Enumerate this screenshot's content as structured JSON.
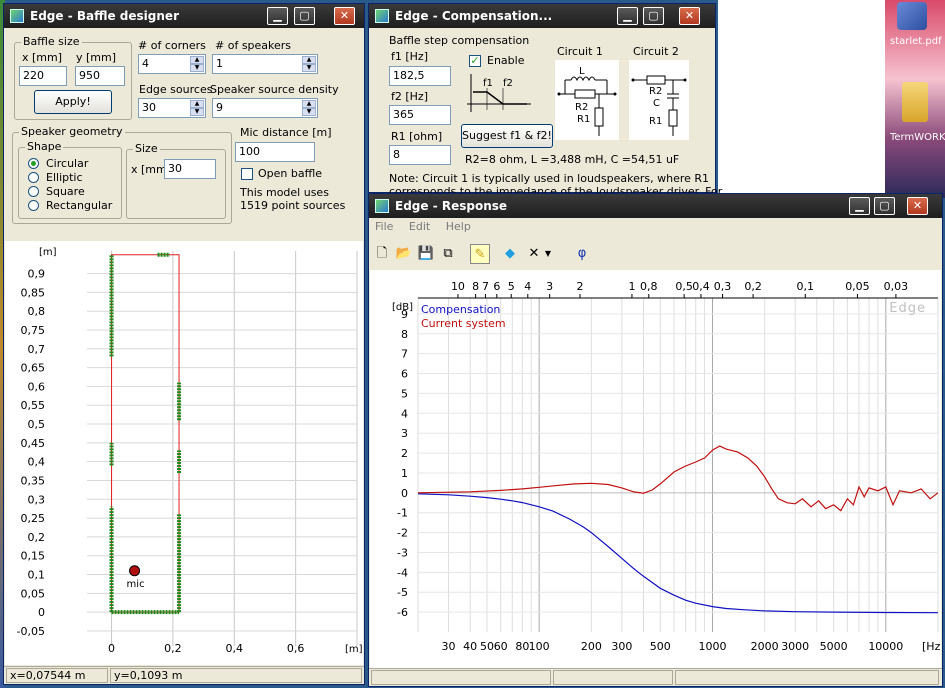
{
  "desktop": {
    "icon_label_1": "starlet.pdf",
    "icon_label_2": "TermWORK"
  },
  "baffle": {
    "title": "Edge - Baffle designer",
    "baffle_size": {
      "group_label": "Baffle size",
      "x_label": "x [mm]",
      "y_label": "y [mm]",
      "x_value": "220",
      "y_value": "950",
      "apply": "Apply!"
    },
    "corners_label": "# of corners",
    "corners_value": "4",
    "speakers_label": "# of speakers",
    "speakers_value": "1",
    "edge_label": "Edge sources",
    "edge_value": "30",
    "density_label": "Speaker source density",
    "density_value": "9",
    "geometry": {
      "group_label": "Speaker geometry",
      "shape_label": "Shape",
      "shapes": [
        "Circular",
        "Elliptic",
        "Square",
        "Rectangular"
      ],
      "selected": 0,
      "size_label": "Size",
      "x_label": "x [mm]",
      "x_value": "30"
    },
    "mic_label": "Mic distance [m]",
    "mic_value": "100",
    "open_baffle": "Open baffle",
    "model_text_1": "This model uses",
    "model_text_2": "1519 point sources",
    "status_x": "x=0,07544 m",
    "status_y": "y=0,1093 m"
  },
  "compensation": {
    "title": "Edge - Compensation...",
    "group_label": "Baffle step compensation",
    "f1_label": "f1 [Hz]",
    "f1_value": "182,5",
    "f2_label": "f2 [Hz]",
    "f2_value": "365",
    "r1_label": "R1 [ohm]",
    "r1_value": "8",
    "enable": "Enable",
    "graph_label_f1": "f1",
    "graph_label_f2": "f2",
    "circuit1": "Circuit 1",
    "circuit2": "Circuit 2",
    "c1_L": "L",
    "c1_R2": "R2",
    "c1_R1": "R1",
    "c2_R2": "R2",
    "c2_C": "C",
    "c2_R1": "R1",
    "suggest": "Suggest f1 & f2!",
    "result": "R2=8 ohm, L =3,488 mH, C =54,51 uF",
    "note_1": "Note: Circuit 1 is typically used in loudspeakers, where R1",
    "note_2": "corresponds to the impedance of the loudspeaker driver. For"
  },
  "response": {
    "title": "Edge - Response",
    "menu": [
      "File",
      "Edit",
      "Help"
    ],
    "tools": {
      "phi": "φ"
    },
    "watermark": "Edge",
    "legend": [
      "Compensation",
      "Current system"
    ],
    "colors": {
      "compensation": "#1010c0",
      "current": "#c01010"
    }
  },
  "chart_data": [
    {
      "type": "scatter",
      "title": "",
      "xlabel": "[m]",
      "ylabel": "[m]",
      "xlim": [
        -0.08,
        0.8
      ],
      "ylim": [
        -0.09,
        0.96
      ],
      "xticks": [
        "0",
        "0,2",
        "0,4",
        "0,6"
      ],
      "yticks": [
        "-0,05",
        "0",
        "0,05",
        "0,1",
        "0,15",
        "0,2",
        "0,25",
        "0,3",
        "0,35",
        "0,4",
        "0,45",
        "0,5",
        "0,55",
        "0,6",
        "0,65",
        "0,7",
        "0,75",
        "0,8",
        "0,85",
        "0,9"
      ],
      "baffle_outline": [
        [
          0,
          0
        ],
        [
          0.22,
          0
        ],
        [
          0.22,
          0.95
        ],
        [
          0,
          0.95
        ]
      ],
      "mic": {
        "x": 0.075,
        "y": 0.11,
        "label": "mic"
      },
      "edge_source_ranges": [
        {
          "edge": "left",
          "from": 0.0,
          "to": 0.28
        },
        {
          "edge": "left",
          "from": 0.39,
          "to": 0.45
        },
        {
          "edge": "left",
          "from": 0.68,
          "to": 0.95
        },
        {
          "edge": "right",
          "from": 0.0,
          "to": 0.26
        },
        {
          "edge": "right",
          "from": 0.37,
          "to": 0.43
        },
        {
          "edge": "right",
          "from": 0.51,
          "to": 0.61
        },
        {
          "edge": "bottom",
          "from": 0.0,
          "to": 0.22
        },
        {
          "edge": "top",
          "from": 0.15,
          "to": 0.19
        }
      ],
      "grid": true
    },
    {
      "type": "line",
      "x_scale": "log",
      "xlim": [
        20,
        20000
      ],
      "ylim": [
        -7,
        9.8
      ],
      "xlabel": "[Hz]",
      "ylabel": "[dB]",
      "xticks": [
        30,
        40,
        50,
        60,
        80,
        100,
        200,
        300,
        500,
        1000,
        2000,
        3000,
        5000,
        10000
      ],
      "yticks": [
        -6,
        -5,
        -4,
        -3,
        -2,
        -1,
        0,
        1,
        2,
        3,
        4,
        5,
        6,
        7,
        8,
        9
      ],
      "top_axis_ticks": [
        {
          "label": "10",
          "hz": 34
        },
        {
          "label": "8",
          "hz": 43
        },
        {
          "label": "7",
          "hz": 49
        },
        {
          "label": "6",
          "hz": 57
        },
        {
          "label": "5",
          "hz": 69
        },
        {
          "label": "4",
          "hz": 86
        },
        {
          "label": "3",
          "hz": 115
        },
        {
          "label": "2",
          "hz": 172
        },
        {
          "label": "1",
          "hz": 343
        },
        {
          "label": "0,8",
          "hz": 429
        },
        {
          "label": "0,5",
          "hz": 686
        },
        {
          "label": "0,4",
          "hz": 858
        },
        {
          "label": "0,3",
          "hz": 1143
        },
        {
          "label": "0,2",
          "hz": 1715
        },
        {
          "label": "0,1",
          "hz": 3430
        },
        {
          "label": "0,05",
          "hz": 6860
        },
        {
          "label": "0,03",
          "hz": 11433
        }
      ],
      "grid": true,
      "series": [
        {
          "name": "Compensation",
          "x": [
            20,
            30,
            40,
            50,
            60,
            70,
            80,
            100,
            120,
            150,
            180,
            200,
            250,
            300,
            350,
            400,
            500,
            600,
            700,
            800,
            1000,
            1200,
            1500,
            2000,
            3000,
            5000,
            10000,
            20000
          ],
          "y": [
            -0.05,
            -0.1,
            -0.17,
            -0.24,
            -0.32,
            -0.4,
            -0.49,
            -0.7,
            -0.92,
            -1.32,
            -1.72,
            -2.0,
            -2.7,
            -3.3,
            -3.8,
            -4.2,
            -4.8,
            -5.15,
            -5.4,
            -5.55,
            -5.72,
            -5.82,
            -5.88,
            -5.94,
            -5.98,
            -6.0,
            -6.02,
            -6.03
          ]
        },
        {
          "name": "Current system",
          "x": [
            20,
            40,
            60,
            80,
            100,
            130,
            160,
            200,
            250,
            300,
            350,
            400,
            450,
            500,
            600,
            700,
            800,
            900,
            1000,
            1100,
            1200,
            1400,
            1600,
            1800,
            2000,
            2200,
            2400,
            2700,
            3000,
            3300,
            3700,
            4100,
            4500,
            5000,
            5500,
            6000,
            6500,
            7000,
            7500,
            8000,
            9000,
            10000,
            11000,
            12000,
            14000,
            16000,
            18000,
            20000
          ],
          "y": [
            0.0,
            0.05,
            0.12,
            0.2,
            0.28,
            0.38,
            0.45,
            0.48,
            0.42,
            0.25,
            0.05,
            -0.02,
            0.15,
            0.45,
            1.05,
            1.35,
            1.55,
            1.75,
            2.15,
            2.35,
            2.2,
            2.05,
            1.75,
            1.35,
            0.8,
            0.2,
            -0.3,
            -0.5,
            -0.55,
            -0.3,
            -0.7,
            -0.4,
            -0.8,
            -0.6,
            -0.9,
            -0.3,
            -0.6,
            0.3,
            -0.2,
            0.25,
            0.1,
            0.3,
            -0.6,
            0.1,
            0.0,
            0.2,
            -0.3,
            0.0
          ]
        }
      ]
    }
  ]
}
